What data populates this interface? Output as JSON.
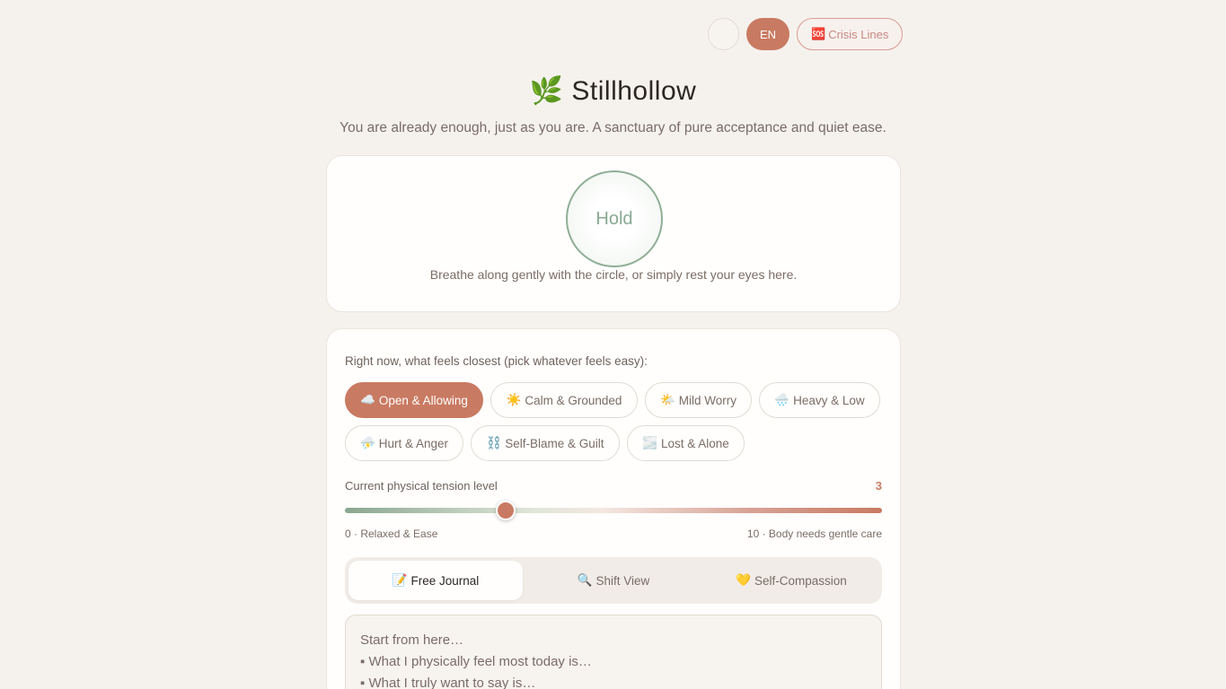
{
  "topbar": {
    "icon_glyph": "",
    "lang_label": "EN",
    "crisis_label": "Crisis Lines",
    "crisis_icon": "🆘"
  },
  "header": {
    "logo_icon": "🌿",
    "title": "Stillhollow",
    "subtitle": "You are already enough, just as you are. A sanctuary of pure acceptance and quiet ease."
  },
  "breathing": {
    "phase_label": "Hold",
    "caption": "Breathe along gently with the circle, or simply rest your eyes here."
  },
  "mood": {
    "prompt": "Right now, what feels closest (pick whatever feels easy):",
    "options": [
      {
        "icon": "☁️",
        "label": "Open & Allowing",
        "selected": true
      },
      {
        "icon": "☀️",
        "label": "Calm & Grounded",
        "selected": false
      },
      {
        "icon": "🌤️",
        "label": "Mild Worry",
        "selected": false
      },
      {
        "icon": "🌧️",
        "label": "Heavy & Low",
        "selected": false
      },
      {
        "icon": "⛈️",
        "label": "Hurt & Anger",
        "selected": false
      },
      {
        "icon": "⛓️",
        "label": "Self-Blame & Guilt",
        "selected": false
      },
      {
        "icon": "🌫️",
        "label": "Lost & Alone",
        "selected": false
      }
    ]
  },
  "tension": {
    "label": "Current physical tension level",
    "value": "3",
    "min": 0,
    "max": 10,
    "min_label": "0 · Relaxed & Ease",
    "max_label": "10 · Body needs gentle care"
  },
  "tabs": [
    {
      "icon": "📝",
      "label": "Free Journal",
      "active": true
    },
    {
      "icon": "🔍",
      "label": "Shift View",
      "active": false
    },
    {
      "icon": "💛",
      "label": "Self-Compassion",
      "active": false
    }
  ],
  "journal": {
    "lines": [
      "Start from here…",
      "▪ What I physically feel most today is…",
      "▪ What I truly want to say is…"
    ]
  },
  "colors": {
    "accent": "#c97a62",
    "sage": "#8aa993",
    "background": "#f5f2ee"
  }
}
